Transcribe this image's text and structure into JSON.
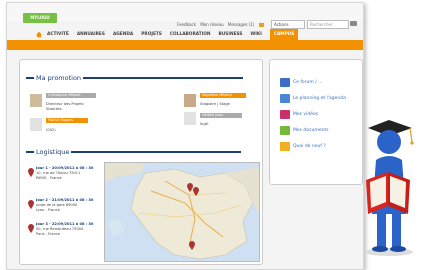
{
  "header": {
    "logo_label": "MYLOGO",
    "user_links": [
      "Feedback",
      "Mon réseau",
      "Messages (1)"
    ],
    "select_value": "Actions",
    "search_placeholder": "Rechercher"
  },
  "nav": {
    "items": [
      "ACTIVITÉ",
      "ANNUAIRES",
      "AGENDA",
      "PROJETS",
      "COLLABORATION",
      "BUSINESS",
      "WIKI"
    ],
    "active": "CAMPUS"
  },
  "promotion": {
    "title": "Ma promotion",
    "person1": {
      "name": "Christophe Mittaut",
      "role": "Directeur des Projets",
      "company": "Stoorkes"
    },
    "person2": {
      "name": "Patrick Rogers",
      "note": "(002)"
    },
    "person3": {
      "name": "Ségolène Mittaut",
      "role": "Stagiaire | Stage"
    },
    "person4": {
      "name": "Hélène Jean",
      "note": "Ingé."
    }
  },
  "logistique": {
    "title": "Logistique",
    "entries": [
      {
        "title": "Jour 1 - 20/09/2011 à 08 : 30",
        "line1": "10, rue de l'Anjou 75011",
        "line2": "PARIS - France"
      },
      {
        "title": "Jour 2 - 21/09/2011 à 08 : 30",
        "line1": "route de la gare 69000",
        "line2": "Lyon - France"
      },
      {
        "title": "Jour 3 - 22/09/2011 à 08 : 30",
        "line1": "50, rue Rambuteau 75004",
        "line2": "Paris - France"
      }
    ]
  },
  "sidebar": {
    "links": [
      {
        "label": "Ce forum / ...",
        "color": "#3a6fc4"
      },
      {
        "label": "Le planning et l'agenda",
        "color": "#4a86d6"
      },
      {
        "label": "Mes vidéos",
        "color": "#c8306a"
      },
      {
        "label": "Mes documents",
        "color": "#76b83a"
      },
      {
        "label": "Quoi de neuf ?",
        "color": "#f0b020"
      }
    ]
  },
  "colors": {
    "accent": "#f39200",
    "brand": "#76c043",
    "heading": "#1c3f78"
  }
}
